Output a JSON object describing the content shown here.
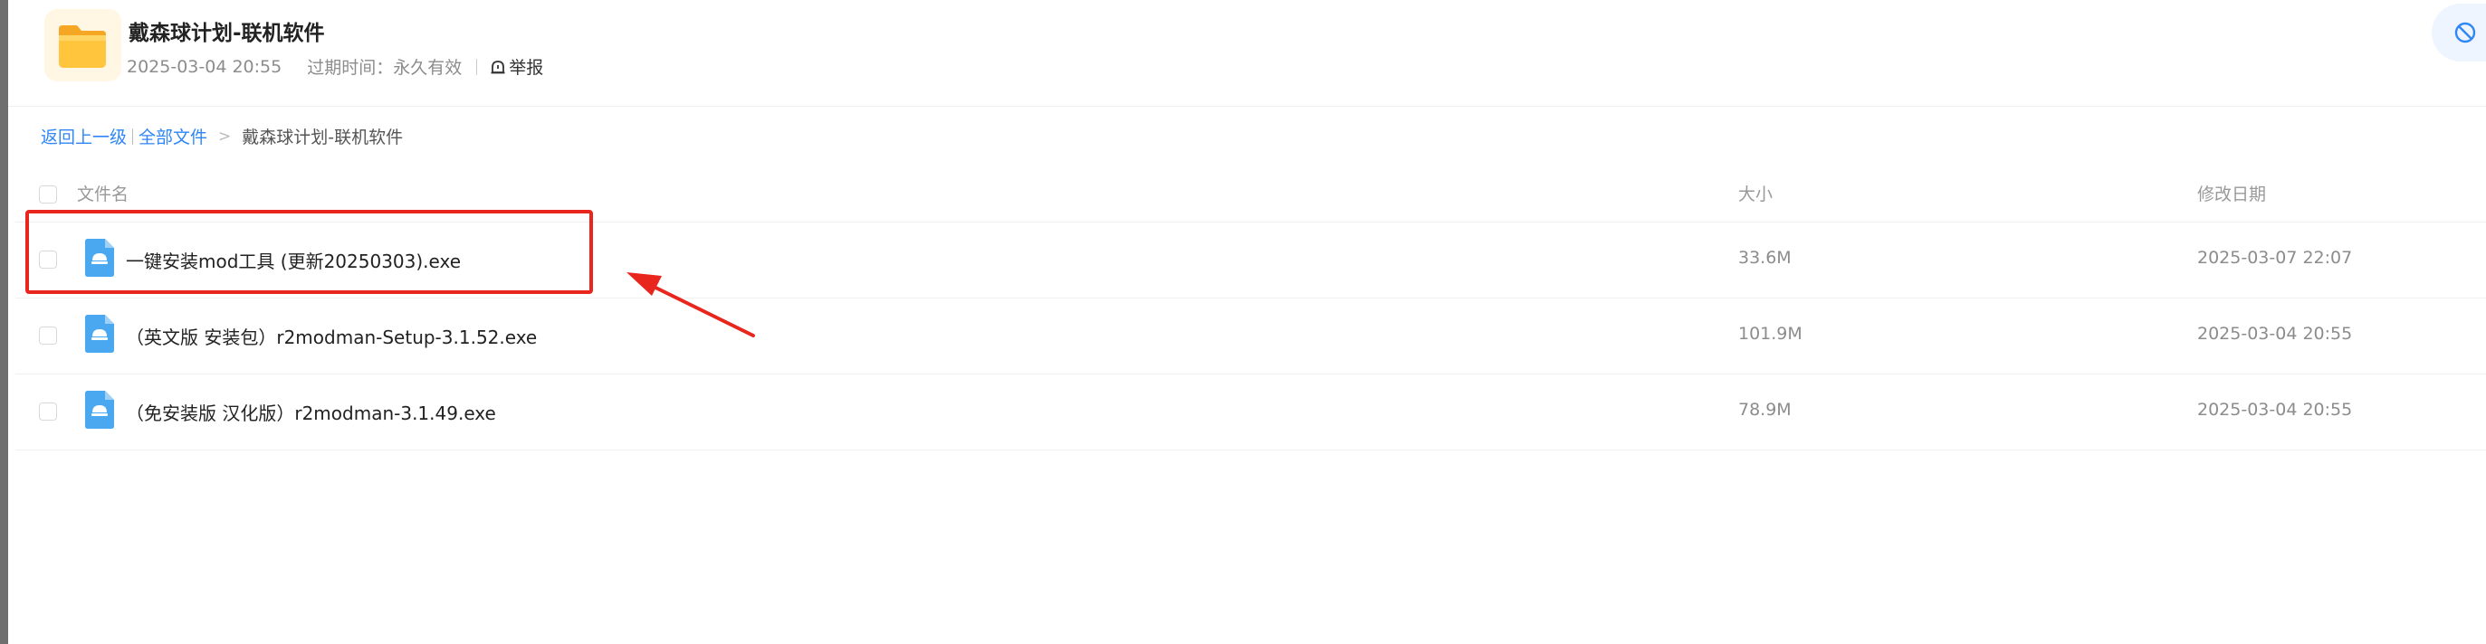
{
  "share": {
    "title": "戴森球计划-联机软件",
    "date": "2025-03-04 20:55",
    "expire": "过期时间：永久有效",
    "report_label": "举报"
  },
  "breadcrumb": {
    "back": "返回上一级",
    "all_files": "全部文件",
    "arrow": ">",
    "current": "戴森球计划-联机软件"
  },
  "table": {
    "headers": {
      "name": "文件名",
      "size": "大小",
      "date": "修改日期"
    },
    "rows": [
      {
        "name": "一键安装mod工具 (更新20250303).exe",
        "size": "33.6M",
        "date": "2025-03-07 22:07"
      },
      {
        "name": "（英文版 安装包）r2modman-Setup-3.1.52.exe",
        "size": "101.9M",
        "date": "2025-03-04 20:55"
      },
      {
        "name": "（免安装版 汉化版）r2modman-3.1.49.exe",
        "size": "78.9M",
        "date": "2025-03-04 20:55"
      }
    ]
  },
  "colors": {
    "accent": "#2f86f6",
    "annotation": "#e8261e",
    "folder": "#ffc53d",
    "file_icon": "#4aa8f0"
  },
  "icons": [
    "folder-icon",
    "report-icon",
    "block-icon",
    "exe-file-icon"
  ]
}
